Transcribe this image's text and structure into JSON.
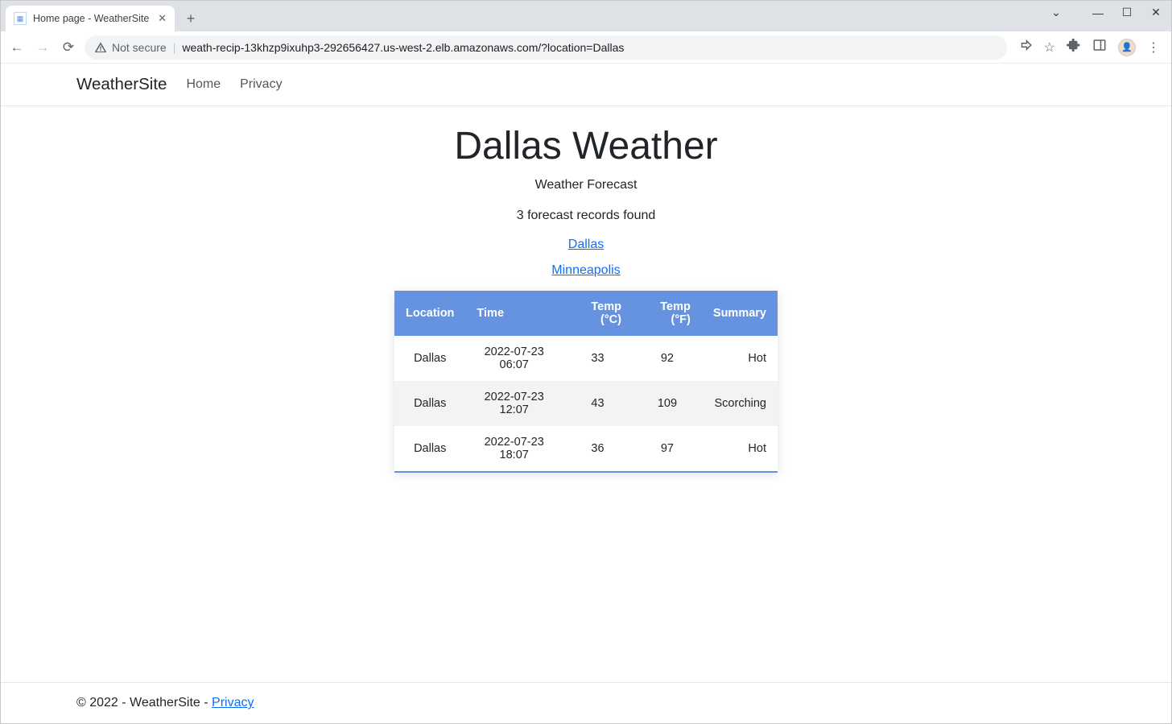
{
  "browser": {
    "tab_title": "Home page - WeatherSite",
    "not_secure_label": "Not secure",
    "url": "weath-recip-13khzp9ixuhp3-292656427.us-west-2.elb.amazonaws.com/?location=Dallas"
  },
  "navbar": {
    "brand": "WeatherSite",
    "links": [
      {
        "label": "Home"
      },
      {
        "label": "Privacy"
      }
    ]
  },
  "main": {
    "title": "Dallas Weather",
    "subtitle": "Weather Forecast",
    "records_found": "3 forecast records found",
    "city_links": [
      {
        "label": "Dallas"
      },
      {
        "label": "Minneapolis"
      }
    ],
    "columns": [
      {
        "label": "Location"
      },
      {
        "label": "Time"
      },
      {
        "label": "Temp (°C)"
      },
      {
        "label": "Temp (°F)"
      },
      {
        "label": "Summary"
      }
    ],
    "rows": [
      {
        "location": "Dallas",
        "time": "2022-07-23 06:07",
        "tc": "33",
        "tf": "92",
        "summary": "Hot"
      },
      {
        "location": "Dallas",
        "time": "2022-07-23 12:07",
        "tc": "43",
        "tf": "109",
        "summary": "Scorching"
      },
      {
        "location": "Dallas",
        "time": "2022-07-23 18:07",
        "tc": "36",
        "tf": "97",
        "summary": "Hot"
      }
    ]
  },
  "footer": {
    "copyright": "© 2022 - WeatherSite - ",
    "privacy_label": "Privacy"
  }
}
